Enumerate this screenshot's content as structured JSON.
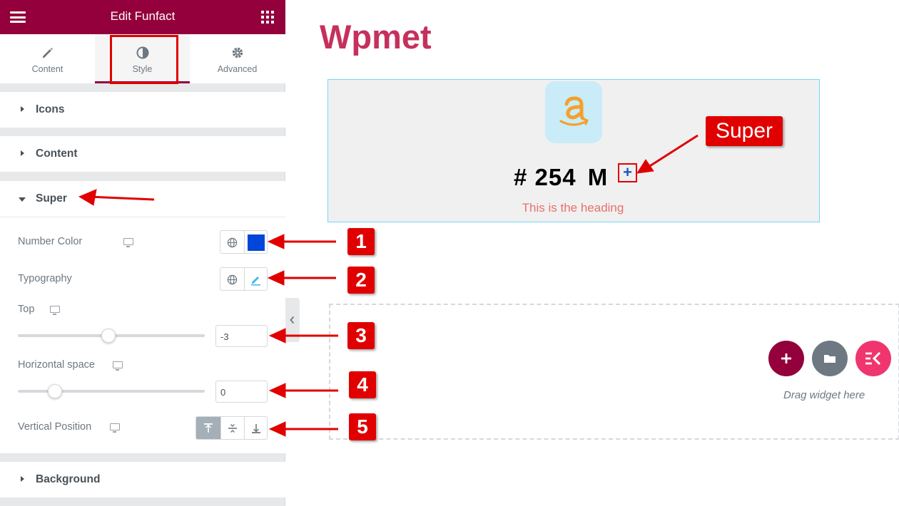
{
  "panel": {
    "title": "Edit Funfact",
    "tabs": [
      {
        "label": "Content",
        "icon": "pencil-icon"
      },
      {
        "label": "Style",
        "icon": "contrast-icon"
      },
      {
        "label": "Advanced",
        "icon": "gear-icon"
      }
    ],
    "active_tab": "Style",
    "sections": {
      "icons": "Icons",
      "content": "Content",
      "super": "Super",
      "background": "Background"
    },
    "controls": {
      "number_color_label": "Number Color",
      "number_color_value": "#0047d9",
      "typography_label": "Typography",
      "top_label": "Top",
      "top_value": "-3",
      "top_slider_level": 0.5,
      "hspace_label": "Horizontal space",
      "hspace_value": "0",
      "hspace_slider_level": 0.2,
      "vpos_label": "Vertical Position",
      "vpos_options": [
        "top",
        "middle",
        "bottom"
      ],
      "vpos_selected": "top"
    }
  },
  "canvas": {
    "site_title": "Wpmet",
    "funfact": {
      "prefix": "#",
      "number": "254",
      "suffix": "M",
      "super": "+",
      "heading": "This is the heading",
      "icon": "amazon-icon"
    },
    "dropzone": {
      "text": "Drag widget here",
      "buttons": [
        "add-section",
        "template-library",
        "elementskit"
      ]
    }
  },
  "annotations": {
    "super_label": "Super",
    "numbers": [
      "1",
      "2",
      "3",
      "4",
      "5"
    ]
  },
  "colors": {
    "brand": "#93003c",
    "annotation_red": "#e00000",
    "title_pink": "#c6305c",
    "heading_coral": "#e8716a"
  }
}
